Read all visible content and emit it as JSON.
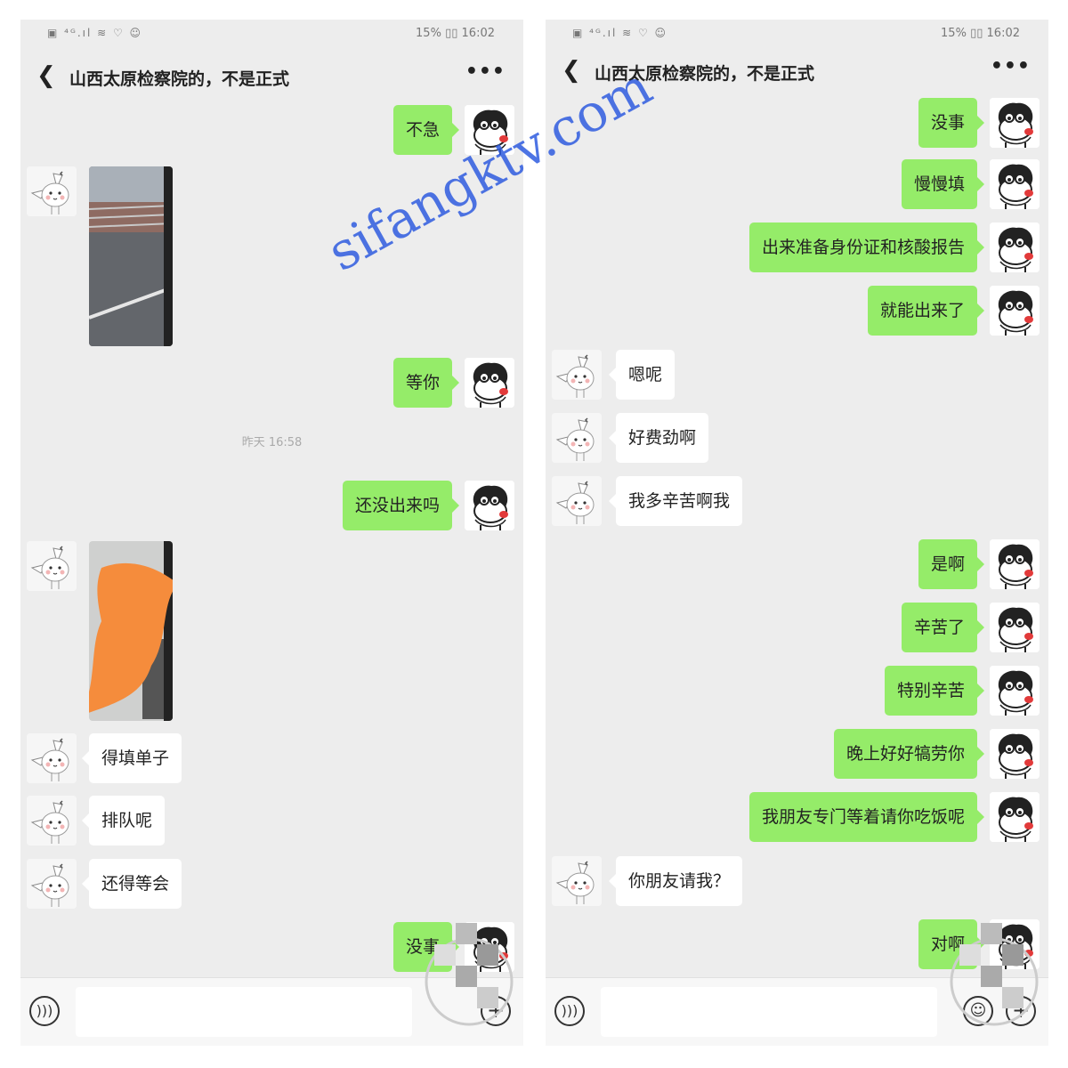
{
  "status": {
    "icons_left": "▣ ⁴ᴳ.ıl ≋ ♡ ☺",
    "battery_icon": "▯▯",
    "battery": "15%",
    "time": "16:02"
  },
  "chat": {
    "back_icon": "chevron-left-icon",
    "title": "山西太原检察院的，不是正式",
    "more_icon": "more-dots-icon"
  },
  "left_screen": {
    "messages": [
      {
        "from": "me",
        "text": "不急"
      },
      {
        "from": "them",
        "kind": "photo"
      },
      {
        "from": "me",
        "text": "等你"
      },
      {
        "kind": "time",
        "text": "昨天 16:58"
      },
      {
        "from": "me",
        "text": "还没出来吗"
      },
      {
        "from": "them",
        "kind": "photo"
      },
      {
        "from": "them",
        "text": "得填单子"
      },
      {
        "from": "them",
        "text": "排队呢"
      },
      {
        "from": "them",
        "text": "还得等会"
      },
      {
        "from": "me",
        "text": "没事"
      }
    ]
  },
  "right_screen": {
    "messages": [
      {
        "from": "me",
        "text": "没事"
      },
      {
        "from": "me",
        "text": "慢慢填"
      },
      {
        "from": "me",
        "text": "出来准备身份证和核酸报告"
      },
      {
        "from": "me",
        "text": "就能出来了"
      },
      {
        "from": "them",
        "text": "嗯呢"
      },
      {
        "from": "them",
        "text": "好费劲啊"
      },
      {
        "from": "them",
        "text": "我多辛苦啊我"
      },
      {
        "from": "me",
        "text": "是啊"
      },
      {
        "from": "me",
        "text": "辛苦了"
      },
      {
        "from": "me",
        "text": "特别辛苦"
      },
      {
        "from": "me",
        "text": "晚上好好犒劳你"
      },
      {
        "from": "me",
        "text": "我朋友专门等着请你吃饭呢"
      },
      {
        "from": "them",
        "text": "你朋友请我？"
      },
      {
        "from": "me",
        "text": "对啊"
      }
    ]
  },
  "watermark": "sifangktv.com",
  "input": {
    "voice_icon": "voice-icon",
    "emoji_icon": "emoji-icon",
    "plus_icon": "plus-icon"
  },
  "colors": {
    "outgoing_bubble": "#95ec69",
    "incoming_bubble": "#ffffff",
    "background": "#ededed"
  }
}
